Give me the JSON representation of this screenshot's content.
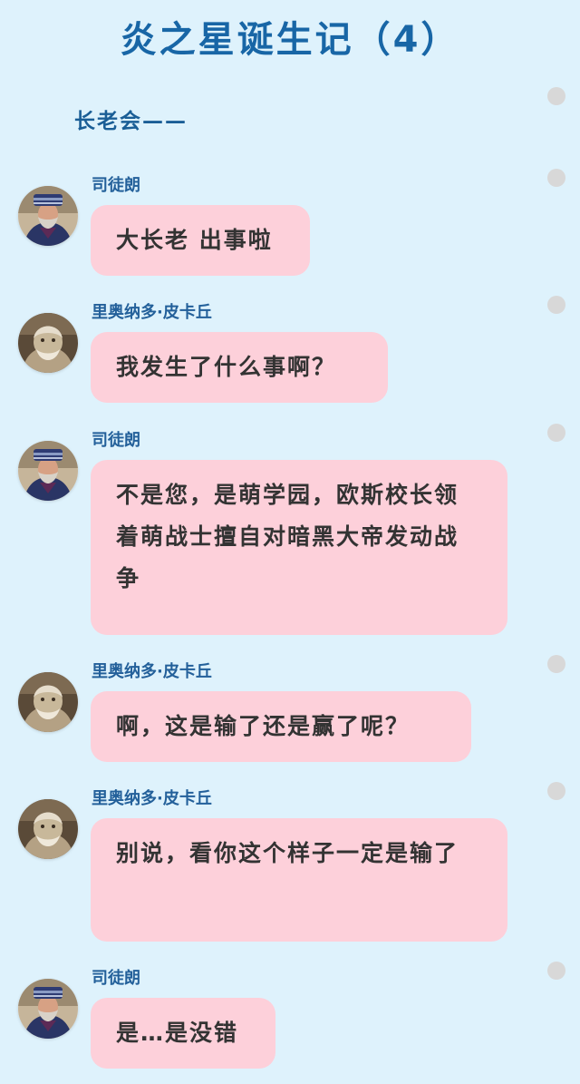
{
  "header": {
    "title": "炎之星诞生记（4）",
    "section_label": "长老会——"
  },
  "messages": [
    {
      "speaker": "司徒朗",
      "avatar": "elder-avatar",
      "text": "大长老 出事啦"
    },
    {
      "speaker": "里奥纳多·皮卡丘",
      "avatar": "beast-elder-avatar",
      "text": "我发生了什么事啊？"
    },
    {
      "speaker": "司徒朗",
      "avatar": "elder-avatar",
      "text": "不是您，是萌学园，欧斯校长领着萌战士擅自对暗黑大帝发动战争"
    },
    {
      "speaker": "里奥纳多·皮卡丘",
      "avatar": "beast-elder-avatar",
      "text": "啊，这是输了还是赢了呢？"
    },
    {
      "speaker": "里奥纳多·皮卡丘",
      "avatar": "beast-elder-avatar",
      "text": "别说，看你这个样子一定是输了"
    },
    {
      "speaker": "司徒朗",
      "avatar": "elder-avatar",
      "text": "是…是没错"
    }
  ],
  "colors": {
    "background": "#def2fc",
    "title": "#1866a6",
    "bubble": "#fdd0da",
    "name": "#23609a",
    "scroll_dot": "#d8d8d8"
  }
}
